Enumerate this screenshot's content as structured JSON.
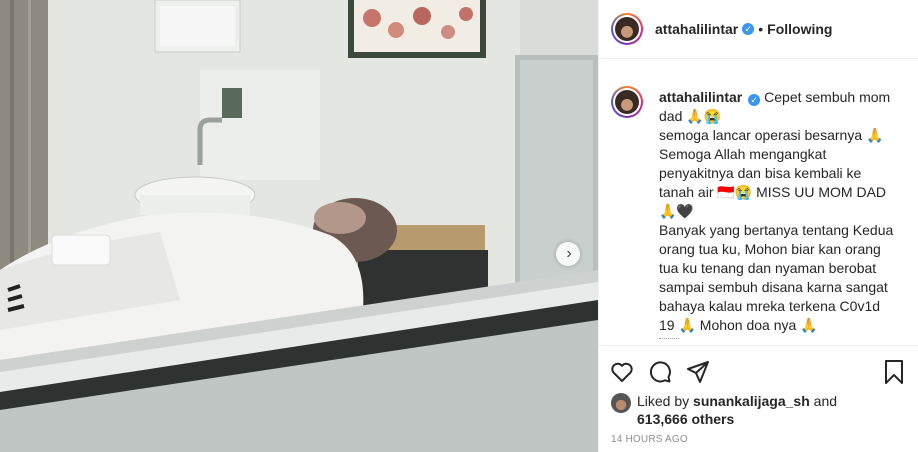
{
  "header": {
    "username": "attahalilintar",
    "separator": "•",
    "following_label": "Following"
  },
  "caption": {
    "username": "attahalilintar",
    "lines": [
      "Cepet sembuh mom dad 🙏😭",
      "semoga lancar operasi besarnya 🙏",
      "Semoga Allah mengangkat penyakitnya dan bisa kembali ke tanah air 🇮🇩😭 MISS UU MOM DAD 🙏🖤",
      "Banyak yang bertanya tentang Kedua orang tua ku, Mohon biar kan orang tua ku tenang dan nyaman berobat sampai sembuh disana karna sangat bahaya kalau mreka terkena C0v1d 19 🙏 Mohon doa nya 🙏"
    ]
  },
  "likes": {
    "prefix": "Liked by",
    "liker": "sunankalijaga_sh",
    "middle": "and",
    "others": "613,666 others"
  },
  "timestamp": "14 HOURS AGO",
  "icons": [
    "verified-badge-icon",
    "heart-icon",
    "comment-icon",
    "share-icon",
    "bookmark-icon",
    "chevron-right-icon"
  ],
  "colors": {
    "verified": "#3897f0",
    "secondary_text": "#8e8e8e",
    "border": "#efefef"
  }
}
